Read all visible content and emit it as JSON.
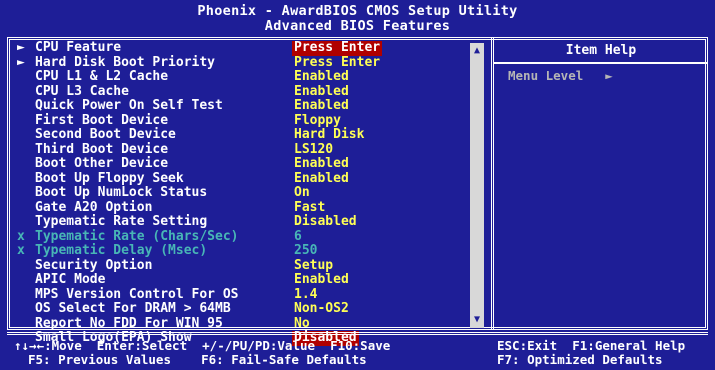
{
  "header": {
    "title": "Phoenix - AwardBIOS CMOS Setup Utility",
    "subtitle": "Advanced BIOS Features"
  },
  "items": [
    {
      "marker": "►",
      "label": "CPU Feature",
      "value": "Press Enter",
      "state": "highlighted"
    },
    {
      "marker": "►",
      "label": "Hard Disk Boot Priority",
      "value": "Press Enter",
      "state": "normal"
    },
    {
      "marker": "",
      "label": "CPU L1 & L2 Cache",
      "value": "Enabled",
      "state": "normal"
    },
    {
      "marker": "",
      "label": "CPU L3 Cache",
      "value": "Enabled",
      "state": "normal"
    },
    {
      "marker": "",
      "label": "Quick Power On Self Test",
      "value": "Enabled",
      "state": "normal"
    },
    {
      "marker": "",
      "label": "First Boot Device",
      "value": "Floppy",
      "state": "normal"
    },
    {
      "marker": "",
      "label": "Second Boot Device",
      "value": "Hard Disk",
      "state": "normal"
    },
    {
      "marker": "",
      "label": "Third Boot Device",
      "value": "LS120",
      "state": "normal"
    },
    {
      "marker": "",
      "label": "Boot Other Device",
      "value": "Enabled",
      "state": "normal"
    },
    {
      "marker": "",
      "label": "Boot Up Floppy Seek",
      "value": "Enabled",
      "state": "normal"
    },
    {
      "marker": "",
      "label": "Boot Up NumLock Status",
      "value": "On",
      "state": "normal"
    },
    {
      "marker": "",
      "label": "Gate A20 Option",
      "value": "Fast",
      "state": "normal"
    },
    {
      "marker": "",
      "label": "Typematic Rate Setting",
      "value": "Disabled",
      "state": "normal"
    },
    {
      "marker": "x",
      "label": "Typematic Rate (Chars/Sec)",
      "value": "6",
      "state": "disabled"
    },
    {
      "marker": "x",
      "label": "Typematic Delay (Msec)",
      "value": "250",
      "state": "disabled"
    },
    {
      "marker": "",
      "label": "Security Option",
      "value": "Setup",
      "state": "normal"
    },
    {
      "marker": "",
      "label": "APIC Mode",
      "value": "Enabled",
      "state": "normal"
    },
    {
      "marker": "",
      "label": "MPS Version Control For OS",
      "value": "1.4",
      "state": "normal"
    },
    {
      "marker": "",
      "label": "OS Select For DRAM > 64MB",
      "value": "Non-OS2",
      "state": "normal"
    },
    {
      "marker": "",
      "label": "Report No FDD For WIN 95",
      "value": "No",
      "state": "normal"
    },
    {
      "marker": "",
      "label": "Small Logo(EPA) Show",
      "value": "Disabled",
      "state": "highlighted"
    }
  ],
  "help": {
    "title": "Item Help",
    "menu_level_label": "Menu Level",
    "menu_level_marker": "►"
  },
  "scrollbar": {
    "up_icon": "▲",
    "down_icon": "▼"
  },
  "footer": {
    "line1_left": "↑↓→←:Move  Enter:Select  +/-/PU/PD:Value  F10:Save",
    "line1_right": "ESC:Exit  F1:General Help",
    "line2_left": "F5: Previous Values    F6: Fail-Safe Defaults",
    "line2_right": "F7: Optimized Defaults"
  }
}
